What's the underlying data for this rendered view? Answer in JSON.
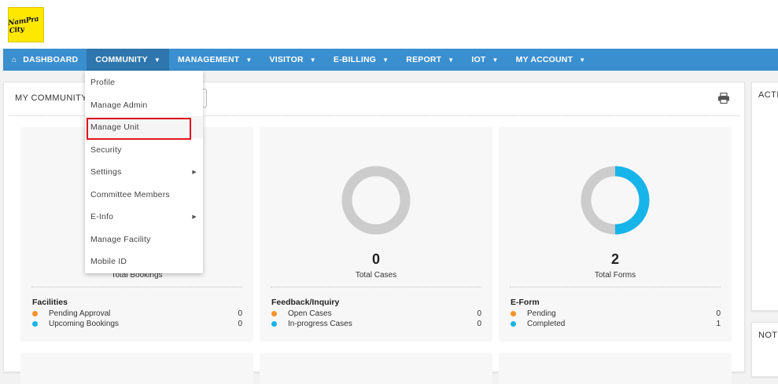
{
  "colors": {
    "nav": "#3a8fcf",
    "nav_active": "#2e76ad",
    "orange": "#f5922b",
    "cyan": "#17b4ea",
    "grey_ring": "#cccccc",
    "highlight": "#e0141b"
  },
  "logo": {
    "text": "NamPra City"
  },
  "nav": {
    "items": [
      {
        "label": "DASHBOARD",
        "icon": "home-icon",
        "caret": false
      },
      {
        "label": "COMMUNITY",
        "caret": true,
        "active": true
      },
      {
        "label": "MANAGEMENT",
        "caret": true
      },
      {
        "label": "VISITOR",
        "caret": true
      },
      {
        "label": "E-BILLING",
        "caret": true
      },
      {
        "label": "REPORT",
        "caret": true
      },
      {
        "label": "IOT",
        "caret": true
      },
      {
        "label": "MY ACCOUNT",
        "caret": true
      }
    ]
  },
  "dropdown": {
    "items": [
      {
        "label": "Profile",
        "submenu": false
      },
      {
        "label": "Manage Admin",
        "submenu": false
      },
      {
        "label": "Manage Unit",
        "submenu": false,
        "highlighted": true
      },
      {
        "label": "Security",
        "submenu": false
      },
      {
        "label": "Settings",
        "submenu": true
      },
      {
        "label": "Committee Members",
        "submenu": false
      },
      {
        "label": "E-Info",
        "submenu": true
      },
      {
        "label": "Manage Facility",
        "submenu": false
      },
      {
        "label": "Mobile ID",
        "submenu": false
      }
    ]
  },
  "main": {
    "title": "MY COMMUNITY"
  },
  "cards": [
    {
      "total": "",
      "total_label": "Total Bookings",
      "section": "Facilities",
      "rows": [
        {
          "label": "Pending Approval",
          "value": "0"
        },
        {
          "label": "Upcoming Bookings",
          "value": "0"
        }
      ],
      "progress": 0
    },
    {
      "total": "0",
      "total_label": "Total Cases",
      "section": "Feedback/Inquiry",
      "rows": [
        {
          "label": "Open Cases",
          "value": "0"
        },
        {
          "label": "In-progress Cases",
          "value": "0"
        }
      ],
      "progress": 0
    },
    {
      "total": "2",
      "total_label": "Total Forms",
      "section": "E-Form",
      "rows": [
        {
          "label": "Pending",
          "value": "0"
        },
        {
          "label": "Completed",
          "value": "1"
        }
      ],
      "progress": 0.5
    }
  ],
  "right": {
    "title1": "ACTI",
    "title2": "NOTI"
  }
}
